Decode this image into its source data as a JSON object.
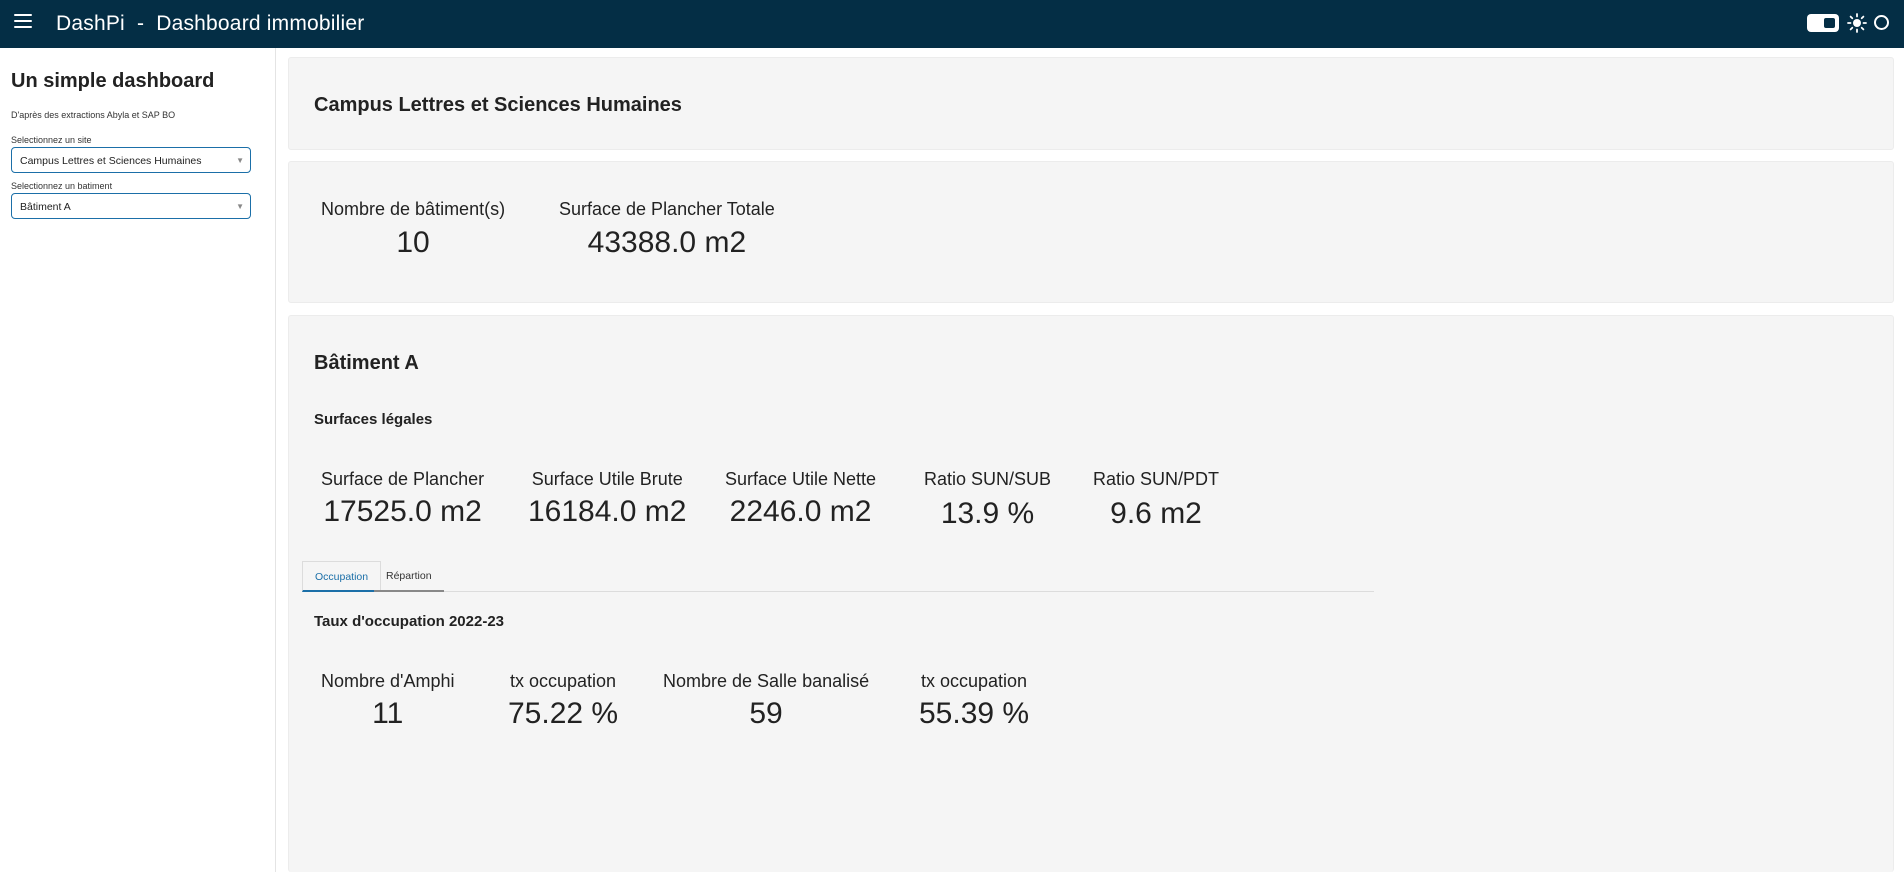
{
  "header": {
    "title": "DashPi  -  Dashboard immobilier",
    "menu_icon": "hamburger-menu-icon",
    "theme_toggle_icon": "toggle-switch-icon",
    "light_icon": "sun-icon",
    "dark_icon": "circle-icon",
    "color": "#042e45"
  },
  "sidebar": {
    "title": "Un simple dashboard",
    "subtitle": "D'après des extractions Abyla et SAP BO",
    "site_label": "Selectionnez un site",
    "site_value": "Campus Lettres et Sciences Humaines",
    "building_label": "Selectionnez un batiment",
    "building_value": "Bâtiment A"
  },
  "site_card": {
    "title": "Campus Lettres et Sciences Humaines"
  },
  "site_kpis": [
    {
      "label": "Nombre de bâtiment(s)",
      "value": "10"
    },
    {
      "label": "Surface de Plancher Totale",
      "value": "43388.0 m2"
    }
  ],
  "building": {
    "title": "Bâtiment A",
    "surfaces_heading": "Surfaces légales",
    "surfaces": [
      {
        "label": "Surface de Plancher",
        "value": "17525.0 m2"
      },
      {
        "label": "Surface Utile Brute",
        "value": "16184.0 m2"
      },
      {
        "label": "Surface Utile Nette",
        "value": "2246.0 m2"
      },
      {
        "label": "Ratio SUN/SUB",
        "value": "13.9 %"
      },
      {
        "label": "Ratio SUN/PDT",
        "value": "9.6 m2"
      }
    ],
    "tabs": [
      "Occupation",
      "Répartion"
    ],
    "active_tab": "Occupation",
    "occupation_heading": "Taux d'occupation 2022-23",
    "occupation": [
      {
        "label": "Nombre d'Amphi",
        "value": "11"
      },
      {
        "label": "tx occupation",
        "value": "75.22 %"
      },
      {
        "label": "Nombre de Salle banalisé",
        "value": "59"
      },
      {
        "label": "tx occupation",
        "value": "55.39 %"
      }
    ],
    "accent_color": "#1b6fa8"
  }
}
